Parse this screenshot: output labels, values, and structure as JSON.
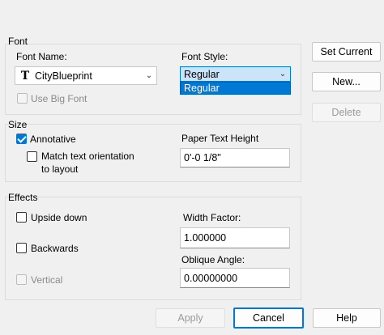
{
  "font_group": {
    "legend": "Font",
    "font_name_label": "Font Name:",
    "font_name_value": "CityBlueprint",
    "font_style_label": "Font Style:",
    "font_style_value": "Regular",
    "font_style_options": [
      "Regular"
    ],
    "use_big_font_label": "Use Big Font",
    "use_big_font_checked": false
  },
  "size_group": {
    "legend": "Size",
    "annotative_label": "Annotative",
    "annotative_checked": true,
    "match_orientation_label_line1": "Match text orientation",
    "match_orientation_label_line2": "to layout",
    "match_orientation_checked": false,
    "paper_text_height_label": "Paper Text Height",
    "paper_text_height_value": "0'-0 1/8\""
  },
  "effects_group": {
    "legend": "Effects",
    "upside_down_label": "Upside down",
    "upside_down_checked": false,
    "backwards_label": "Backwards",
    "backwards_checked": false,
    "vertical_label": "Vertical",
    "vertical_checked": false,
    "width_factor_label": "Width Factor:",
    "width_factor_value": "1.000000",
    "oblique_angle_label": "Oblique Angle:",
    "oblique_angle_value": "0.00000000"
  },
  "side_buttons": {
    "set_current": "Set Current",
    "new": "New...",
    "delete": "Delete"
  },
  "bottom_buttons": {
    "apply": "Apply",
    "cancel": "Cancel",
    "help": "Help"
  },
  "icons": {
    "truetype_font": "truetype-font-icon",
    "chevron": "chevron-down-icon"
  },
  "colors": {
    "accent": "#0078d4",
    "background": "#f0f0f0"
  }
}
